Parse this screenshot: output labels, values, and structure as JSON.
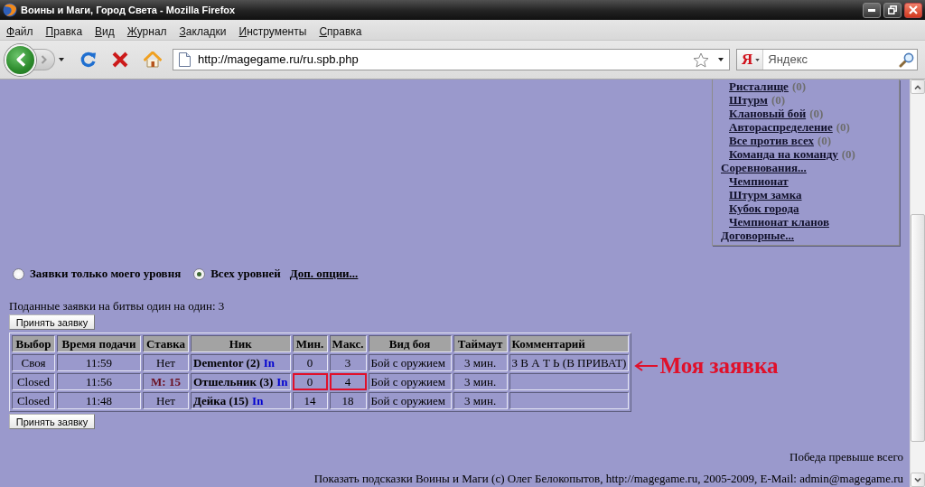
{
  "window": {
    "title": "Воины и Маги, Город Света - Mozilla Firefox"
  },
  "menu_bar": [
    "Файл",
    "Правка",
    "Вид",
    "Журнал",
    "Закладки",
    "Инструменты",
    "Справка"
  ],
  "toolbar": {
    "address": "http://magegame.ru/ru.spb.php",
    "search": {
      "engine": "Я",
      "placeholder": "Яндекс"
    }
  },
  "side_menu": {
    "groups": [
      {
        "children": [
          {
            "label": "Ристалище",
            "count": "(0)"
          },
          {
            "label": "Штурм",
            "count": "(0)"
          },
          {
            "label": "Клановый бой",
            "count": "(0)"
          },
          {
            "label": "Автораспределение",
            "count": "(0)"
          },
          {
            "label": "Все против всех",
            "count": "(0)"
          },
          {
            "label": "Команда на команду",
            "count": "(0)"
          }
        ]
      },
      {
        "label": "Соревнования...",
        "children": [
          {
            "label": "Чемпионат"
          },
          {
            "label": "Штурм замка"
          },
          {
            "label": "Кубок города"
          },
          {
            "label": "Чемпионат кланов"
          }
        ]
      },
      {
        "label": "Договорные..."
      }
    ]
  },
  "filter": {
    "options": [
      {
        "label": "Заявки только моего уровня",
        "selected": false
      },
      {
        "label": "Всех уровней",
        "selected": true
      }
    ],
    "link": "Доп. опции..."
  },
  "bids": {
    "summary": "Поданные заявки на битвы один на один: 3",
    "button_top": "Принять заявку",
    "button_bottom": "Принять заявку",
    "table": {
      "columns": [
        "Выбор",
        "Время подачи",
        "Ставка",
        "Ник",
        "Мин.",
        "Макс.",
        "Вид боя",
        "Таймаут",
        "Комментарий"
      ],
      "rows": [
        {
          "choice": "Своя",
          "time": "11:59",
          "stake": {
            "kind": "none",
            "text": "Нет"
          },
          "nick": {
            "name": "Dementor (2)",
            "link": "In"
          },
          "min": "0",
          "max": "3",
          "range_highlighted": false,
          "battle_type": "Бой с оружием",
          "timeout": "3 мин.",
          "comment": "З В А Т Ь (В ПРИВАТ)"
        },
        {
          "choice": "Closed",
          "time": "11:56",
          "stake": {
            "kind": "bet",
            "text": "M: 15"
          },
          "nick": {
            "name": "Отшельник (3)",
            "link": "In"
          },
          "min": "0",
          "max": "4",
          "range_highlighted": true,
          "battle_type": "Бой с оружием",
          "timeout": "3 мин."
        },
        {
          "choice": "Closed",
          "time": "11:48",
          "stake": {
            "kind": "none",
            "text": "Нет"
          },
          "nick": {
            "name": "Дейка (15)",
            "link": "In"
          },
          "min": "14",
          "max": "18",
          "range_highlighted": false,
          "battle_type": "Бой с оружием",
          "timeout": "3 мин."
        }
      ]
    },
    "annotation": {
      "text": "Моя заявка"
    }
  },
  "motto": "Победа превыше всего",
  "footer": "Показать подсказки Воины и Маги (c) Олег Белокопытов, http://magegame.ru, 2005-2009, E-Mail: admin@magegame.ru"
}
